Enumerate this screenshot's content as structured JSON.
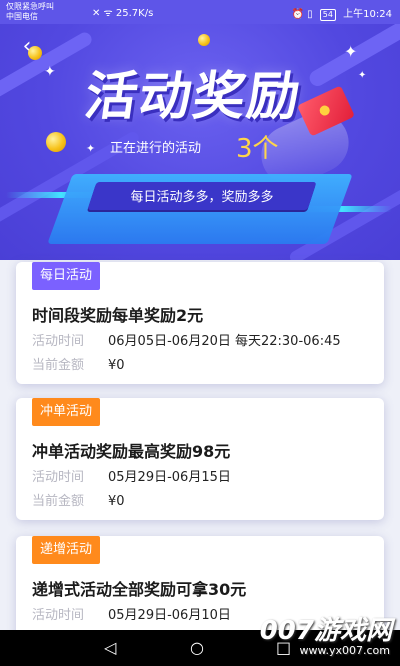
{
  "status_bar": {
    "carrier_line1": "仅限紧急呼叫",
    "carrier_line2": "中国电信",
    "network_speed": "25.7K/s",
    "battery": "54",
    "time": "上午10:24"
  },
  "header": {
    "title": "活动奖励",
    "ongoing_label": "正在进行的活动",
    "ongoing_count": "3个",
    "slogan": "每日活动多多，奖励多多"
  },
  "cards": [
    {
      "tag": "每日活动",
      "tag_color": "#7b61ff",
      "title": "时间段奖励每单奖励2元",
      "time_label": "活动时间",
      "time_value": "06月05日-06月20日 每天22:30-06:45",
      "amount_label": "当前金额",
      "amount_value": "¥0"
    },
    {
      "tag": "冲单活动",
      "tag_color": "#ff8a1c",
      "title": "冲单活动奖励最高奖励98元",
      "time_label": "活动时间",
      "time_value": "05月29日-06月15日",
      "amount_label": "当前金额",
      "amount_value": "¥0"
    },
    {
      "tag": "递增活动",
      "tag_color": "#ff8a1c",
      "title": "递增式活动全部奖励可拿30元",
      "time_label": "活动时间",
      "time_value": "05月29日-06月10日"
    }
  ],
  "watermark": {
    "logo": "007游戏网",
    "url": "www.yx007.com"
  },
  "nav": {
    "back": "◁",
    "home": "○",
    "recent": "□"
  },
  "colors": {
    "header_purple": "#5248e0",
    "accent_yellow": "#ffd54a",
    "tag_purple": "#7b61ff",
    "tag_orange": "#ff8a1c"
  }
}
